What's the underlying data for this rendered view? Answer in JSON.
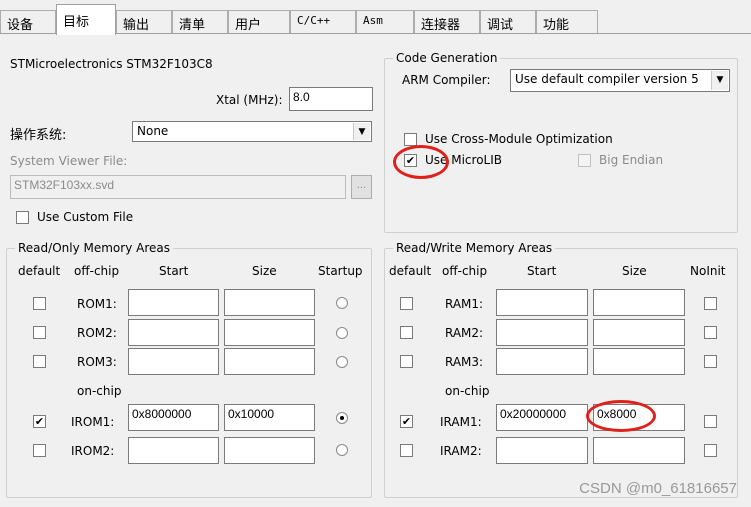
{
  "tabs": [
    "设备",
    "目标",
    "输出",
    "清单",
    "用户",
    "C/C++",
    "Asm",
    "连接器",
    "调试",
    "功能"
  ],
  "device_name": "STMicroelectronics STM32F103C8",
  "xtal_label": "Xtal (MHz):",
  "xtal_value": "8.0",
  "os_label": "操作系统:",
  "os_value": "None",
  "sv_file_label": "System Viewer File:",
  "sv_file_value": "STM32F103xx.svd",
  "sv_browse": "...",
  "use_custom_file": "Use Custom File",
  "code_gen": {
    "legend": "Code Generation",
    "arm_compiler_label": "ARM Compiler:",
    "arm_compiler_value": "Use default compiler version 5",
    "cross_module": "Use Cross-Module Optimization",
    "microlib": "Use MicroLIB",
    "big_endian": "Big Endian"
  },
  "ro": {
    "legend": "Read/Only Memory Areas",
    "headers": [
      "default",
      "off-chip",
      "Start",
      "Size",
      "Startup"
    ],
    "on_chip_label": "on-chip",
    "rows": [
      {
        "label": "ROM1:",
        "start": "",
        "size": ""
      },
      {
        "label": "ROM2:",
        "start": "",
        "size": ""
      },
      {
        "label": "ROM3:",
        "start": "",
        "size": ""
      },
      {
        "label": "IROM1:",
        "start": "0x8000000",
        "size": "0x10000"
      },
      {
        "label": "IROM2:",
        "start": "",
        "size": ""
      }
    ]
  },
  "rw": {
    "legend": "Read/Write Memory Areas",
    "headers": [
      "default",
      "off-chip",
      "Start",
      "Size",
      "NoInit"
    ],
    "on_chip_label": "on-chip",
    "rows": [
      {
        "label": "RAM1:",
        "start": "",
        "size": ""
      },
      {
        "label": "RAM2:",
        "start": "",
        "size": ""
      },
      {
        "label": "RAM3:",
        "start": "",
        "size": ""
      },
      {
        "label": "IRAM1:",
        "start": "0x20000000",
        "size": "0x8000"
      },
      {
        "label": "IRAM2:",
        "start": "",
        "size": ""
      }
    ]
  },
  "check_mark": "✔",
  "dropdown_arrow": "▼",
  "watermark": "CSDN @m0_61816657",
  "colors": {
    "annotation_red": "#e0201a"
  }
}
